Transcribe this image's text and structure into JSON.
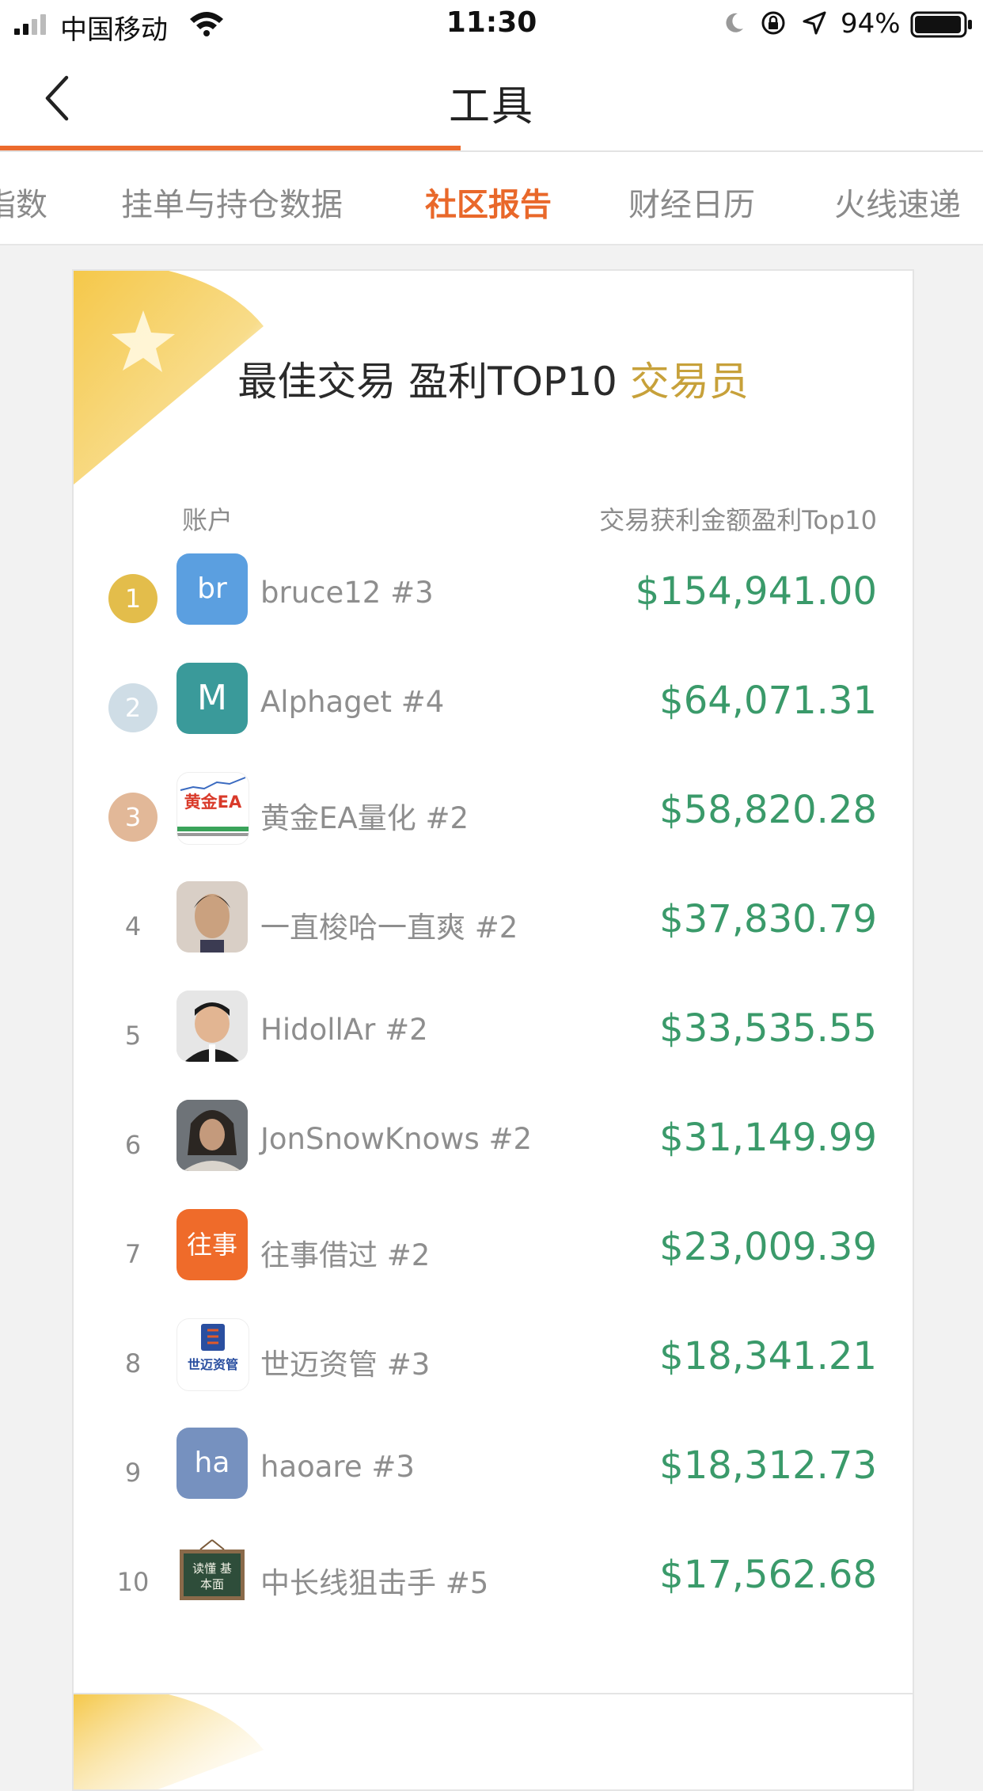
{
  "status_bar": {
    "carrier": "中国移动",
    "time": "11:30",
    "battery": "94%"
  },
  "nav": {
    "title": "工具"
  },
  "tabs": [
    "指数",
    "挂单与持仓数据",
    "社区报告",
    "财经日历",
    "火线速递"
  ],
  "active_tab": "社区报告",
  "report": {
    "title_main": "最佳交易 盈利TOP10",
    "title_highlight": "交易员",
    "col_account": "账户",
    "col_profit": "交易获利金额盈利Top10",
    "rows": [
      {
        "rank": "1",
        "avatar_text": "br",
        "avatar_color": "#5b9fe0",
        "name": "bruce12 #3",
        "amount": "$154,941.00"
      },
      {
        "rank": "2",
        "avatar_text": "M",
        "avatar_color": "#3a9a9a",
        "name": "Alphaget #4",
        "amount": "$64,071.31"
      },
      {
        "rank": "3",
        "avatar_text": "黄金EA",
        "avatar_color": "#ffffff",
        "name": "黄金EA量化 #2",
        "amount": "$58,820.28"
      },
      {
        "rank": "4",
        "avatar_text": "",
        "avatar_color": "#b48c70",
        "name": "一直梭哈一直爽 #2",
        "amount": "$37,830.79"
      },
      {
        "rank": "5",
        "avatar_text": "",
        "avatar_color": "#3a3a3a",
        "name": "HidollAr #2",
        "amount": "$33,535.55"
      },
      {
        "rank": "6",
        "avatar_text": "",
        "avatar_color": "#5a5d63",
        "name": "JonSnowKnows #2",
        "amount": "$31,149.99"
      },
      {
        "rank": "7",
        "avatar_text": "往事",
        "avatar_color": "#ef6b2a",
        "name": "往事借过 #2",
        "amount": "$23,009.39"
      },
      {
        "rank": "8",
        "avatar_text": "世迈资管",
        "avatar_color": "#ffffff",
        "name": "世迈资管 #3",
        "amount": "$18,341.21"
      },
      {
        "rank": "9",
        "avatar_text": "ha",
        "avatar_color": "#7691bf",
        "name": "haoare #3",
        "amount": "$18,312.73"
      },
      {
        "rank": "10",
        "avatar_text": "读懂 基本面",
        "avatar_color": "#2e4d3a",
        "name": "中长线狙击手 #5",
        "amount": "$17,562.68"
      }
    ],
    "rank_colors": [
      "#e3bd4b",
      "#cfdde6",
      "#e2b898"
    ]
  },
  "colors": {
    "accent": "#ec6b2d",
    "amount_green": "#3a9a6a",
    "highlight_gold": "#c7a13a"
  },
  "icons": [
    "signal-icon",
    "wifi-icon",
    "moon-icon",
    "rotation-lock-icon",
    "location-icon",
    "battery-icon",
    "back-chevron-icon",
    "star-decoration-icon"
  ]
}
